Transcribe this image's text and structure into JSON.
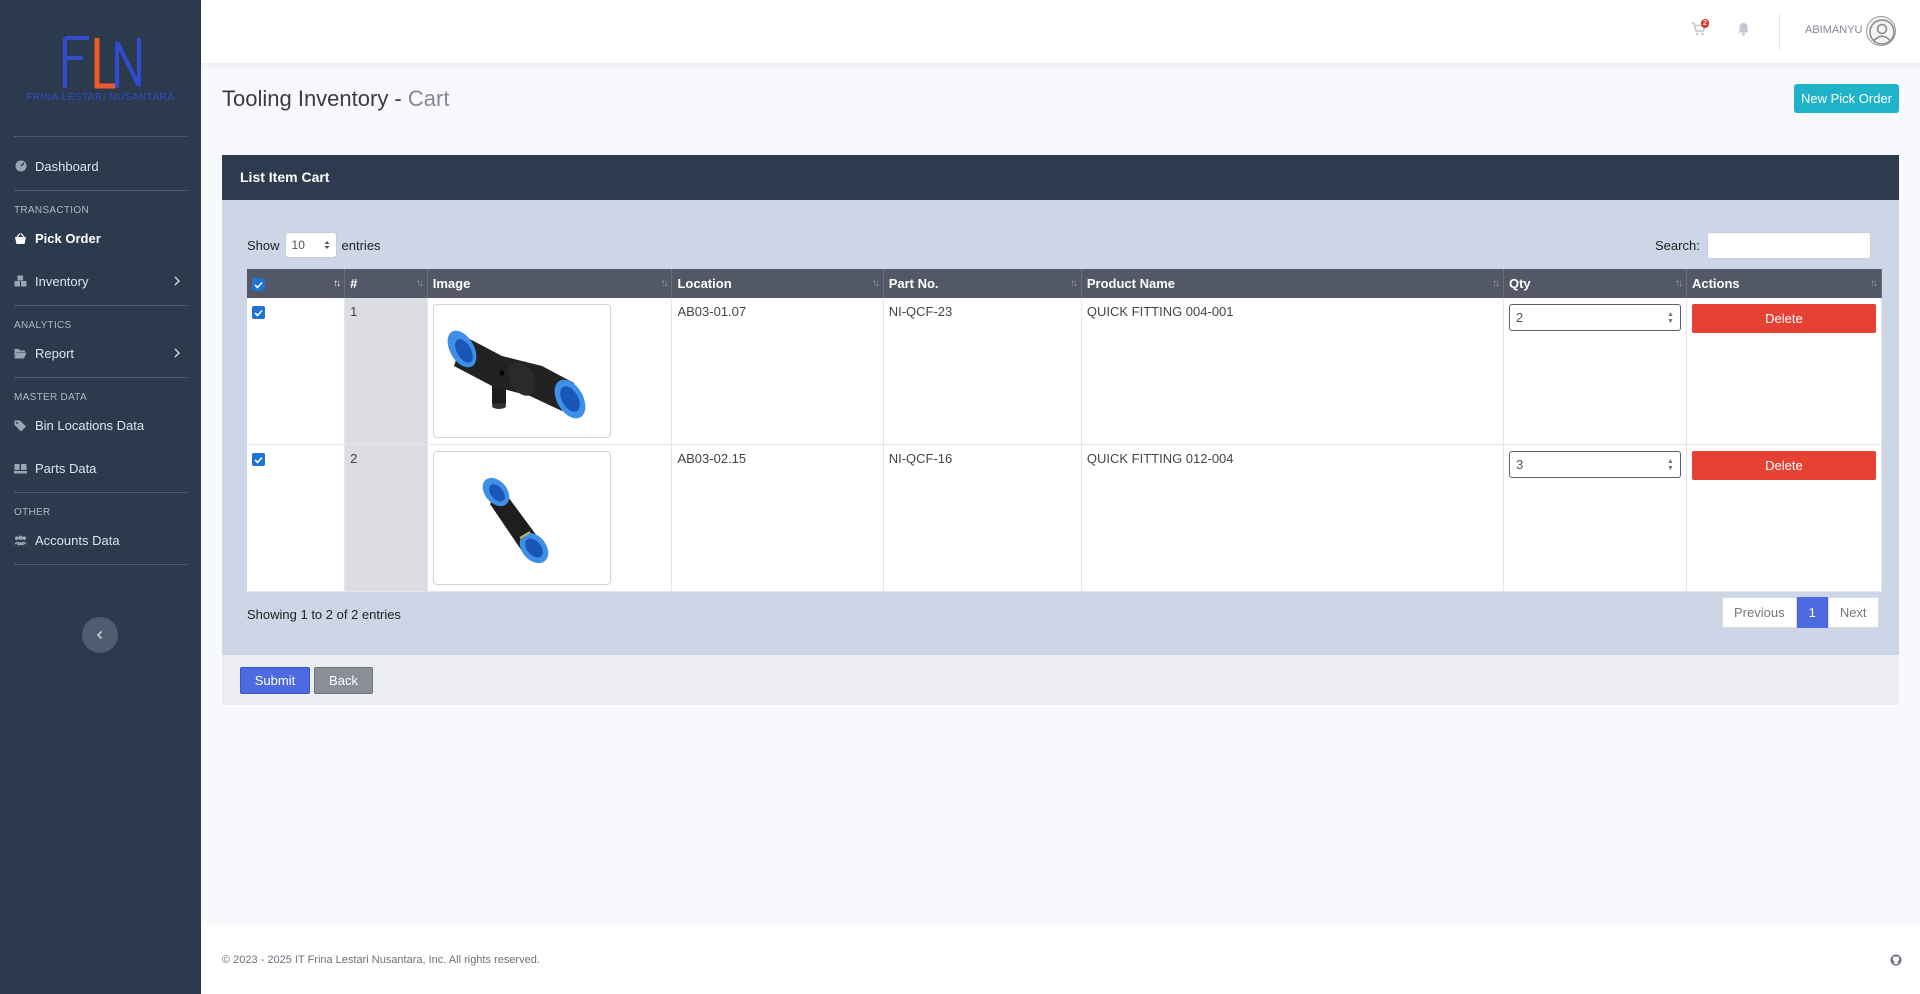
{
  "brand": {
    "logo_letters": "FLN",
    "logo_subtitle": "FRINA LESTARI NUSANTARA",
    "colors": {
      "blue": "#2f4dcc",
      "orange": "#f05a28"
    }
  },
  "sidebar": {
    "dashboard": "Dashboard",
    "sections": {
      "transaction": "TRANSACTION",
      "analytics": "ANALYTICS",
      "master": "MASTER DATA",
      "other": "OTHER"
    },
    "items": {
      "pick_order": "Pick Order",
      "inventory": "Inventory",
      "report": "Report",
      "bin_locations": "Bin Locations Data",
      "parts": "Parts Data",
      "accounts": "Accounts Data"
    }
  },
  "topbar": {
    "cart_count": "2",
    "user_name": "ABIMANYU"
  },
  "page": {
    "title": "Tooling Inventory - ",
    "subtitle": "Cart",
    "new_button": "New Pick Order"
  },
  "card": {
    "title": "List Item Cart",
    "show_label": "Show",
    "entries_label": "entries",
    "page_length": "10",
    "search_label": "Search:",
    "search_value": "",
    "columns": [
      "#",
      "Image",
      "Location",
      "Part No.",
      "Product Name",
      "Qty",
      "Actions"
    ],
    "rows": [
      {
        "checked": true,
        "no": "1",
        "location": "AB03-01.07",
        "part_no": "NI-QCF-23",
        "product": "QUICK FITTING 004-001",
        "qty": "2",
        "action": "Delete"
      },
      {
        "checked": true,
        "no": "2",
        "location": "AB03-02.15",
        "part_no": "NI-QCF-16",
        "product": "QUICK FITTING 012-004",
        "qty": "3",
        "action": "Delete"
      }
    ],
    "info": "Showing 1 to 2 of 2 entries",
    "pagination": {
      "previous": "Previous",
      "current": "1",
      "next": "Next"
    },
    "submit": "Submit",
    "back": "Back"
  },
  "footer": {
    "copyright": "© 2023 - 2025  IT Frina Lestari Nusantara, Inc. All rights reserved."
  }
}
